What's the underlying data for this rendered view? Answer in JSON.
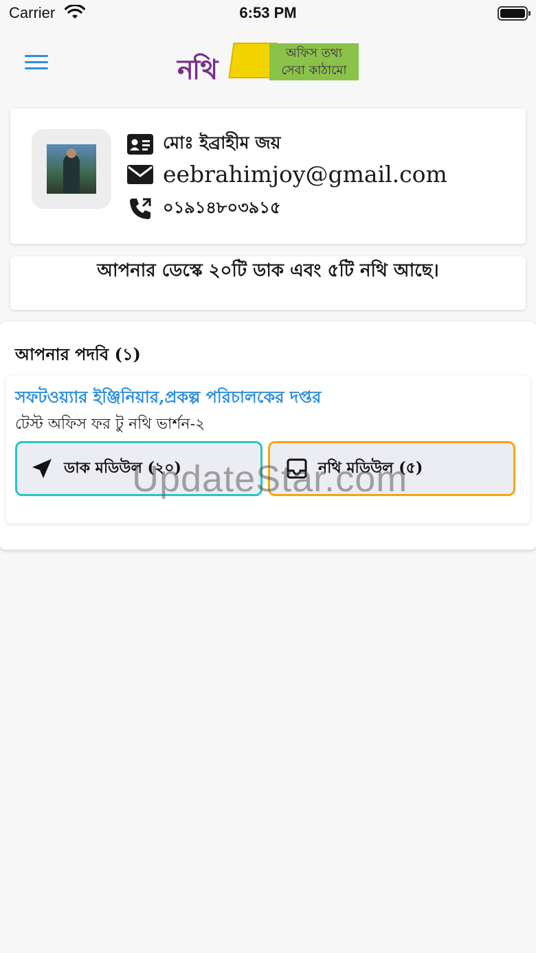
{
  "status_bar": {
    "carrier": "Carrier",
    "time": "6:53 PM",
    "icons": [
      "wifi-icon",
      "battery-icon"
    ]
  },
  "header": {
    "menu_icon": "hamburger-menu-icon",
    "logo": {
      "mark": "নথি",
      "tagline_line1": "অফিস তথ্য",
      "tagline_line2": "সেবা কাঠামো",
      "colors": {
        "mark": "#7a2e8e",
        "envelope": "#f4d400",
        "tag": "#8bc34a"
      }
    }
  },
  "profile": {
    "name": "মোঃ ইব্রাহীম জয়",
    "email": "eebrahimjoy@gmail.com",
    "phone": "০১৯১৪৮০৩৯১৫",
    "icons": {
      "name": "id-card-icon",
      "email": "envelope-icon",
      "phone": "phone-call-icon"
    }
  },
  "notice": {
    "text": "আপনার ডেস্কে ২০টি ডাক এবং ৫টি নথি আছে।"
  },
  "designations": {
    "title": "আপনার পদবি (১)",
    "items": [
      {
        "role": "সফটওয়্যার ইঞ্জিনিয়ার,প্রকল্প পরিচালকের দপ্তর",
        "office": "টেস্ট অফিস ফর টু নথি ভার্শন-২",
        "dak_button": "ডাক মডিউল (২০)",
        "nothi_button": "নথি মডিউল (৫)"
      }
    ]
  },
  "watermark": "UpdateStar.com",
  "colors": {
    "accent_blue": "#2d8fe0",
    "dak_border": "#26c6c2",
    "nothi_border": "#f5a70a",
    "button_bg": "#ececf3",
    "background": "#f7f7f7"
  }
}
